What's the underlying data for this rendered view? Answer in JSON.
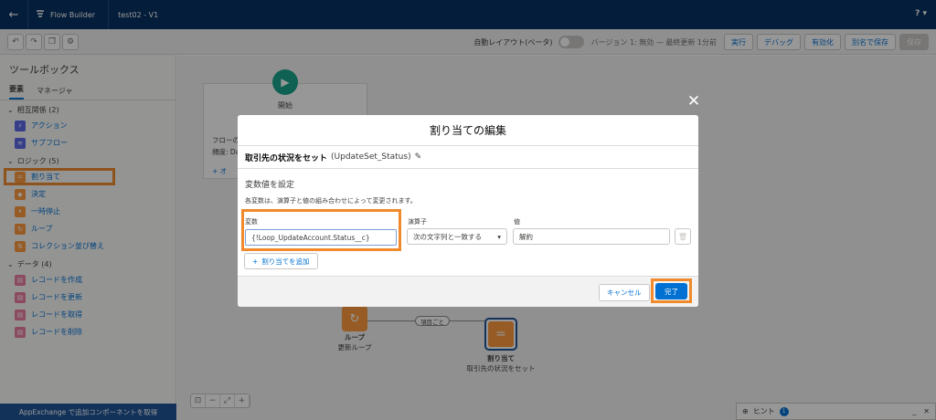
{
  "topbar": {
    "back_icon": "←",
    "app_name": "Flow Builder",
    "flow_title": "test02 - V1",
    "help_label": "?"
  },
  "toolbar": {
    "auto_layout_label": "自動レイアウト(ベータ)",
    "version_status": "バージョン 1: 無効 — 最終更新 1分前",
    "buttons": {
      "run": "実行",
      "debug": "デバッグ",
      "activate": "有効化",
      "save_as": "別名で保存",
      "save": "保存"
    }
  },
  "sidebar": {
    "title": "ツールボックス",
    "tabs": [
      "要素",
      "マネージャ"
    ],
    "sections": {
      "interaction": "相互関係 (2)",
      "logic": "ロジック (5)",
      "data": "データ (4)"
    },
    "items": {
      "action": "アクション",
      "subflow": "サブフロー",
      "assignment": "割り当て",
      "decision": "決定",
      "pause": "一時停止",
      "loop": "ループ",
      "collection_sort": "コレクション並び替え",
      "create_records": "レコードを作成",
      "update_records": "レコードを更新",
      "get_records": "レコードを取得",
      "delete_records": "レコードを削除"
    },
    "footer": "AppExchange で追加コンポーネントを取得"
  },
  "canvas": {
    "start_label": "開始",
    "start_line1": "フローの",
    "start_line2": "頻度: Da",
    "start_line3": "+ オ",
    "loop_label": "ループ",
    "loop_sub": "更新ループ",
    "each_label": "項目ごと",
    "assign_label": "割り当て",
    "assign_sub": "取引先の状況をセット",
    "hint_label": "ヒント",
    "hint_count": "1"
  },
  "modal": {
    "title": "割り当ての編集",
    "element_label": "取引先の状況をセット",
    "element_api": "(UpdateSet_Status)",
    "section_title": "変数値を設定",
    "section_desc": "各変数は、演算子と値の組み合わせによって変更されます。",
    "variable_label": "変数",
    "variable_value": "{!Loop_UpdateAccount.Status__c}",
    "operator_label": "演算子",
    "operator_value": "次の文字列と一致する",
    "value_label": "値",
    "value_value": "解約",
    "add_label": "割り当てを追加",
    "cancel_label": "キャンセル",
    "done_label": "完了"
  },
  "colors": {
    "header": "#032d60",
    "brand": "#0070d2",
    "highlight": "#f08a2c"
  }
}
